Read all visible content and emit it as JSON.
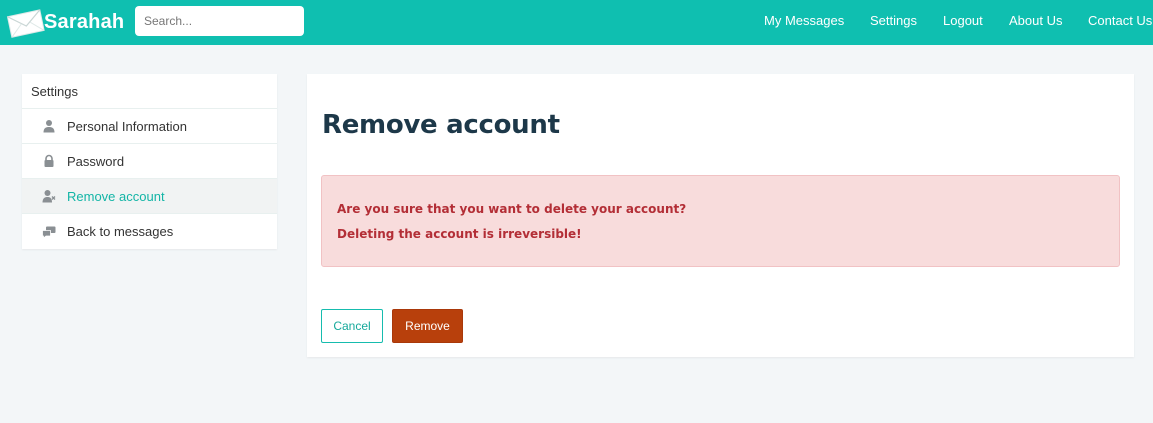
{
  "brand": {
    "name": "Sarahah",
    "icon": "envelope-icon"
  },
  "search": {
    "placeholder": "Search..."
  },
  "nav": {
    "links": [
      "My Messages",
      "Settings",
      "Logout",
      "About Us",
      "Contact Us"
    ]
  },
  "sidebar": {
    "heading": "Settings",
    "items": [
      {
        "label": "Personal Information",
        "icon": "user-icon",
        "active": false
      },
      {
        "label": "Password",
        "icon": "lock-icon",
        "active": false
      },
      {
        "label": "Remove account",
        "icon": "user-remove-icon",
        "active": true
      },
      {
        "label": "Back to messages",
        "icon": "messages-icon",
        "active": false
      }
    ]
  },
  "main": {
    "title": "Remove account",
    "alert": {
      "line1": "Are you sure that you want to delete your account?",
      "line2": "Deleting the account is irreversible!"
    },
    "cancel_label": "Cancel",
    "remove_label": "Remove"
  },
  "colors": {
    "navbar": "#0fbfb0",
    "accent": "#13b5a6",
    "danger_button": "#b8400c",
    "alert_bg": "#f8dcdc",
    "alert_text": "#b32e36"
  }
}
